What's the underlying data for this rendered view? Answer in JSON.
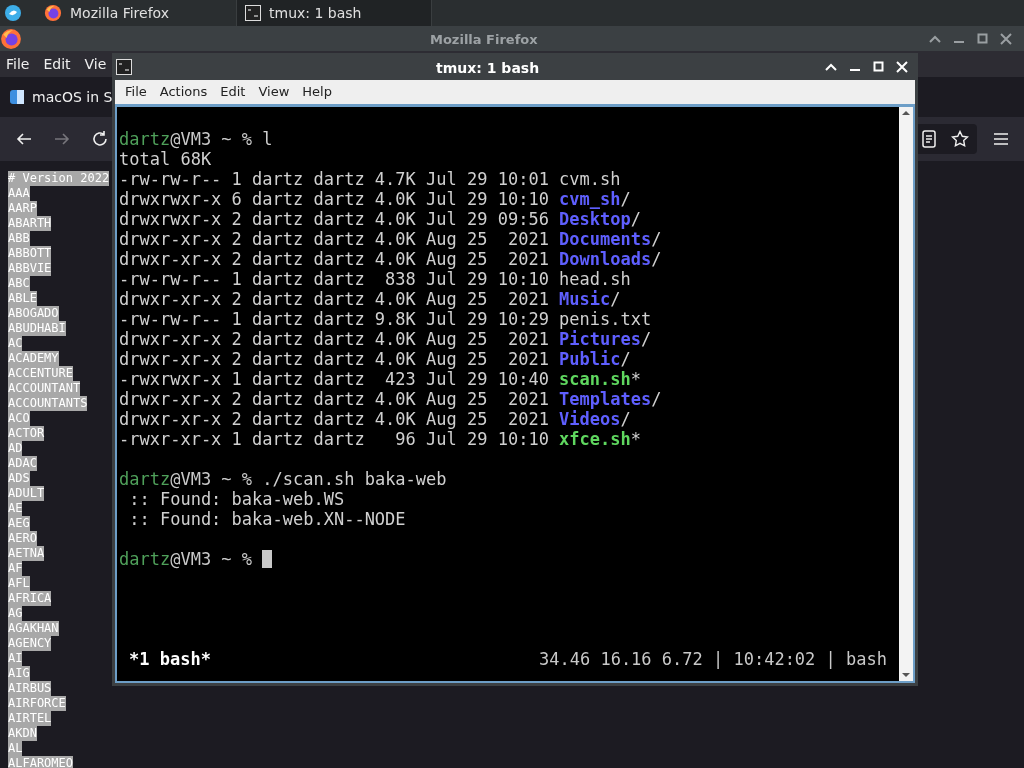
{
  "taskbar": {
    "tasks": [
      {
        "title": "Mozilla Firefox",
        "selected": false
      },
      {
        "title": "tmux: 1 bash",
        "selected": true
      }
    ]
  },
  "firefox": {
    "title": "Mozilla Firefox",
    "menu": [
      "File",
      "Edit",
      "Vie"
    ],
    "tab": "macOS in S",
    "list": [
      "# Version 2022",
      "AAA",
      "AARP",
      "ABARTH",
      "ABB",
      "ABBOTT",
      "ABBVIE",
      "ABC",
      "ABLE",
      "ABOGADO",
      "ABUDHABI",
      "AC",
      "ACADEMY",
      "ACCENTURE",
      "ACCOUNTANT",
      "ACCOUNTANTS",
      "ACO",
      "ACTOR",
      "AD",
      "ADAC",
      "ADS",
      "ADULT",
      "AE",
      "AEG",
      "AERO",
      "AETNA",
      "AF",
      "AFL",
      "AFRICA",
      "AG",
      "AGAKHAN",
      "AGENCY",
      "AI",
      "AIG",
      "AIRBUS",
      "AIRFORCE",
      "AIRTEL",
      "AKDN",
      "AL",
      "ALFAROMEO"
    ]
  },
  "terminal": {
    "title": "tmux: 1 bash",
    "menu": [
      "File",
      "Actions",
      "Edit",
      "View",
      "Help"
    ],
    "lines": [
      {
        "kind": "blank"
      },
      {
        "kind": "prompt",
        "user": "dartz",
        "rest": "@VM3 ~ % ",
        "command": "l"
      },
      {
        "kind": "text",
        "text": "total 68K"
      },
      {
        "kind": "file",
        "info": "-rw-rw-r-- 1 dartz dartz 4.7K Jul 29 10:01 ",
        "name": "cvm.sh"
      },
      {
        "kind": "dir",
        "info": "drwxrwxr-x 6 dartz dartz 4.0K Jul 29 10:10 ",
        "name": "cvm_sh",
        "suffix": "/"
      },
      {
        "kind": "dir",
        "info": "drwxrwxr-x 2 dartz dartz 4.0K Jul 29 09:56 ",
        "name": "Desktop",
        "suffix": "/"
      },
      {
        "kind": "dir",
        "info": "drwxr-xr-x 2 dartz dartz 4.0K Aug 25  2021 ",
        "name": "Documents",
        "suffix": "/"
      },
      {
        "kind": "dir",
        "info": "drwxr-xr-x 2 dartz dartz 4.0K Aug 25  2021 ",
        "name": "Downloads",
        "suffix": "/"
      },
      {
        "kind": "file",
        "info": "-rw-rw-r-- 1 dartz dartz  838 Jul 29 10:10 ",
        "name": "head.sh"
      },
      {
        "kind": "dir",
        "info": "drwxr-xr-x 2 dartz dartz 4.0K Aug 25  2021 ",
        "name": "Music",
        "suffix": "/"
      },
      {
        "kind": "file",
        "info": "-rw-rw-r-- 1 dartz dartz 9.8K Jul 29 10:29 ",
        "name": "penis.txt"
      },
      {
        "kind": "dir",
        "info": "drwxr-xr-x 2 dartz dartz 4.0K Aug 25  2021 ",
        "name": "Pictures",
        "suffix": "/"
      },
      {
        "kind": "dir",
        "info": "drwxr-xr-x 2 dartz dartz 4.0K Aug 25  2021 ",
        "name": "Public",
        "suffix": "/"
      },
      {
        "kind": "exec",
        "info": "-rwxrwxr-x 1 dartz dartz  423 Jul 29 10:40 ",
        "name": "scan.sh",
        "suffix": "*"
      },
      {
        "kind": "dir",
        "info": "drwxr-xr-x 2 dartz dartz 4.0K Aug 25  2021 ",
        "name": "Templates",
        "suffix": "/"
      },
      {
        "kind": "dir",
        "info": "drwxr-xr-x 2 dartz dartz 4.0K Aug 25  2021 ",
        "name": "Videos",
        "suffix": "/"
      },
      {
        "kind": "exec",
        "info": "-rwxr-xr-x 1 dartz dartz   96 Jul 29 10:10 ",
        "name": "xfce.sh",
        "suffix": "*"
      },
      {
        "kind": "blank"
      },
      {
        "kind": "prompt",
        "user": "dartz",
        "rest": "@VM3 ~ % ",
        "command": "./scan.sh baka-web"
      },
      {
        "kind": "text",
        "text": " :: Found: baka-web.WS"
      },
      {
        "kind": "text",
        "text": " :: Found: baka-web.XN--NODE"
      },
      {
        "kind": "blank"
      },
      {
        "kind": "prompt",
        "user": "dartz",
        "rest": "@VM3 ~ % ",
        "cursor": true
      }
    ],
    "status": {
      "window": "*1 bash*",
      "info": "34.46 16.16 6.72 | 10:42:02 | bash"
    }
  }
}
